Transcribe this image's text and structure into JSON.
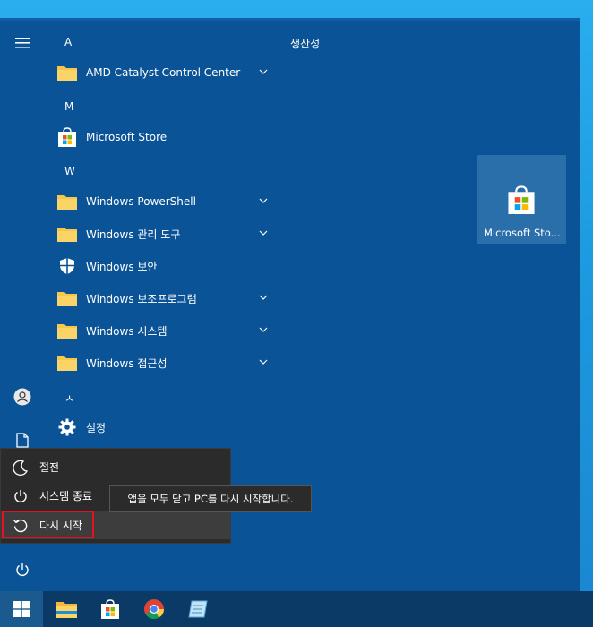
{
  "start_menu": {
    "rail": {
      "hamburger_icon": "hamburger-icon",
      "user_icon": "user-icon",
      "documents_icon": "document-icon",
      "power_icon": "power-icon"
    },
    "app_list": {
      "letter_a": "A",
      "letter_m": "M",
      "letter_w": "W",
      "letter_s": "ㅅ",
      "items": [
        {
          "label": "AMD Catalyst Control Center",
          "icon": "folder-icon",
          "expandable": true
        },
        {
          "label": "Microsoft Store",
          "icon": "store-icon",
          "expandable": false
        },
        {
          "label": "Windows PowerShell",
          "icon": "folder-icon",
          "expandable": true
        },
        {
          "label": "Windows 관리 도구",
          "icon": "folder-icon",
          "expandable": true
        },
        {
          "label": "Windows 보안",
          "icon": "shield-icon",
          "expandable": false
        },
        {
          "label": "Windows 보조프로그램",
          "icon": "folder-icon",
          "expandable": true
        },
        {
          "label": "Windows 시스템",
          "icon": "folder-icon",
          "expandable": true
        },
        {
          "label": "Windows 접근성",
          "icon": "folder-icon",
          "expandable": true
        },
        {
          "label": "설정",
          "icon": "gear-icon",
          "expandable": false
        }
      ]
    },
    "tiles": {
      "group_title": "생산성",
      "tile_label": "Microsoft Sto..."
    },
    "power_menu": {
      "sleep": "절전",
      "shutdown": "시스템 종료",
      "restart": "다시 시작"
    },
    "tooltip": "앱을 모두 닫고 PC를 다시 시작합니다."
  },
  "taskbar": {
    "items": [
      "windows-start-icon",
      "file-explorer-icon",
      "store-icon",
      "chrome-icon",
      "notepad-icon"
    ]
  },
  "colors": {
    "menu_bg": "#0a5396",
    "tile_bg": "#2b6faa",
    "power_menu_bg": "#2b2b2b",
    "highlight": "#e81123",
    "taskbar_bg": "#0b3a67"
  }
}
